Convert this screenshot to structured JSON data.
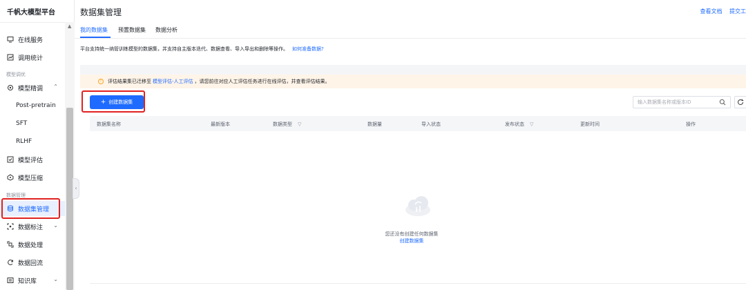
{
  "sidebar": {
    "brand": "千帆大模型平台",
    "items": {
      "online_service": "在线服务",
      "usage_stats": "调用统计",
      "group_model_tuning": "模型调优",
      "model_finetune": "模型精调",
      "post_pretrain": "Post-pretrain",
      "sft": "SFT",
      "rlhf": "RLHF",
      "model_eval": "模型评估",
      "model_compress": "模型压缩",
      "group_data_manage": "数据管理",
      "dataset_manage": "数据集管理",
      "data_label": "数据标注",
      "data_process": "数据处理",
      "data_backflow": "数据回流",
      "knowledge_base": "知识库"
    }
  },
  "main": {
    "title": "数据集管理",
    "top_links": [
      "查看文档",
      "提交工"
    ],
    "tabs": [
      "我的数据集",
      "预置数据集",
      "数据分析"
    ],
    "active_tab": "我的数据集",
    "intro": "平台支持统一纳管训练模型的数据集，并支持自主版本迭代、数据查看、导入导出和删除等操作。",
    "intro_link": "如何准备数据?",
    "notice": {
      "prefix": "评估结果集已迁移至",
      "link": "模型评估-人工评估",
      "suffix": "，请您前往对应人工评估任务进行在线评估，并查看评估结果。"
    },
    "create_button": "创建数据集",
    "search_placeholder": "输入数据集名称或版本ID",
    "columns": [
      "数据集名称",
      "最新版本",
      "数据类型",
      "数据量",
      "导入状态",
      "发布状态",
      "更新时间",
      "操作"
    ],
    "empty_text": "您还没有创建任何数据集",
    "empty_link": "创建数据集"
  },
  "colors": {
    "accent": "#1f6bff",
    "highlight": "#e02020",
    "notice_bg": "#fff4e8"
  },
  "icons": [
    "monitor-icon",
    "stats-icon",
    "tuning-icon",
    "eval-icon",
    "compress-icon",
    "database-icon",
    "label-icon",
    "process-icon",
    "backflow-icon",
    "knowledge-icon",
    "search-icon",
    "refresh-icon",
    "warning-icon",
    "empty-cloud-icon"
  ]
}
